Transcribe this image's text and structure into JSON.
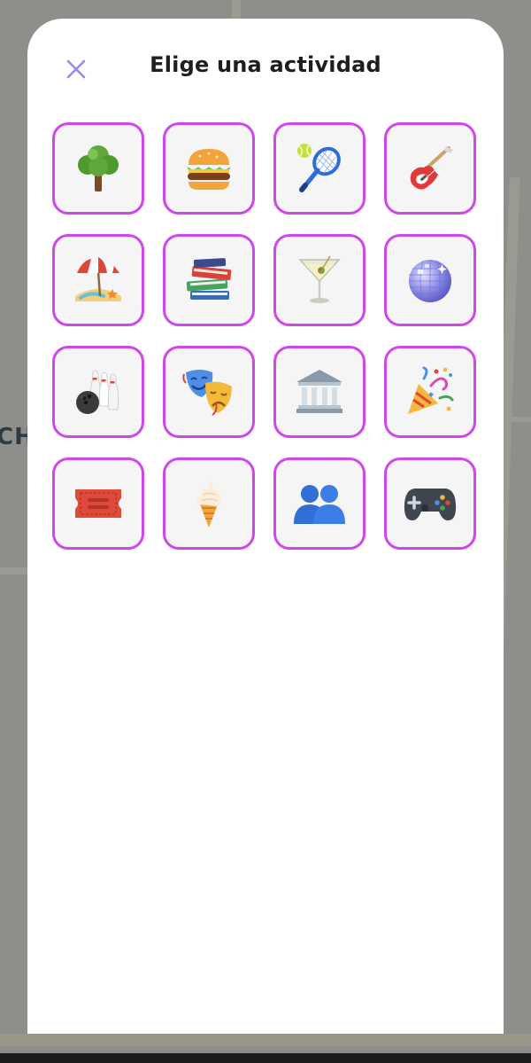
{
  "sheet": {
    "title": "Elige una actividad",
    "close_icon": "close-icon"
  },
  "map": {
    "partial_label": "CH"
  },
  "activities": [
    {
      "icon": "tree-icon"
    },
    {
      "icon": "burger-icon"
    },
    {
      "icon": "tennis-icon"
    },
    {
      "icon": "guitar-icon"
    },
    {
      "icon": "beach-icon"
    },
    {
      "icon": "books-icon"
    },
    {
      "icon": "cocktail-icon"
    },
    {
      "icon": "disco-ball-icon"
    },
    {
      "icon": "bowling-icon"
    },
    {
      "icon": "theater-masks-icon"
    },
    {
      "icon": "museum-icon"
    },
    {
      "icon": "party-popper-icon"
    },
    {
      "icon": "ticket-icon"
    },
    {
      "icon": "ice-cream-icon"
    },
    {
      "icon": "people-icon"
    },
    {
      "icon": "gamepad-icon"
    }
  ],
  "colors": {
    "tile_border": "#cf47ea",
    "tile_bg": "#f5f5f5",
    "close_icon": "#9a85f0",
    "title": "#1e1e1e"
  }
}
